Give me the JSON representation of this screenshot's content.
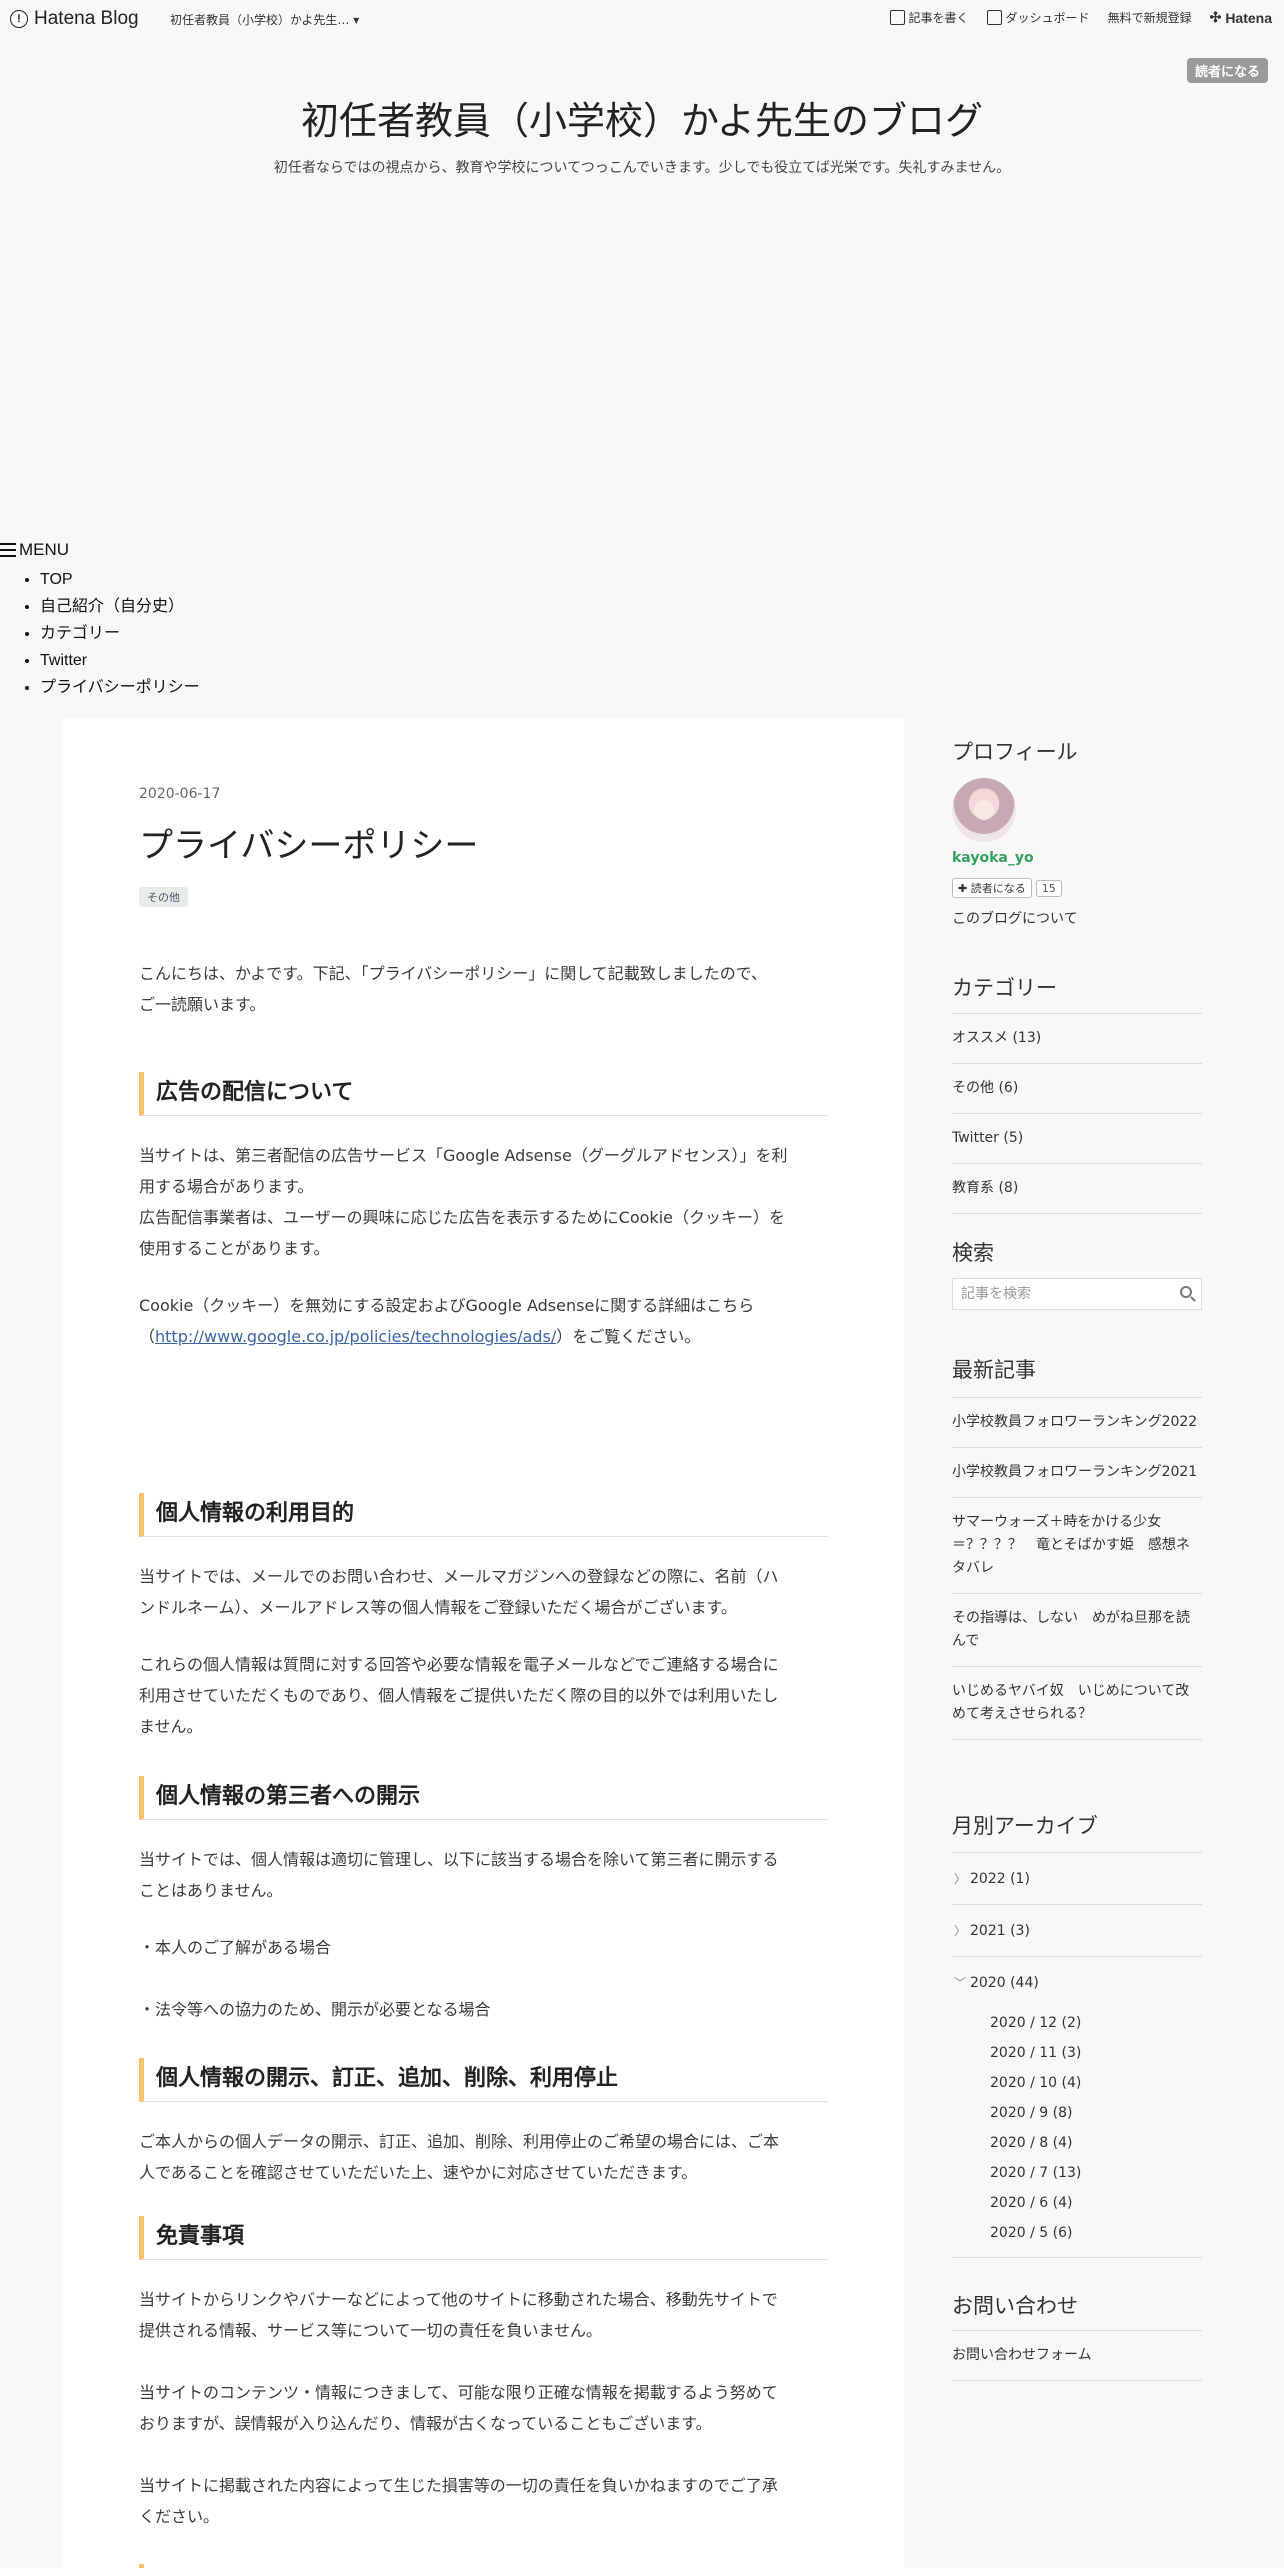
{
  "globalbar": {
    "logo_text": "Hatena Blog",
    "blog_select": "初任者教員（小学校）かよ先生…",
    "write": "記事を書く",
    "dashboard": "ダッシュボード",
    "signup": "無料で新規登録",
    "brand": "Hatena"
  },
  "subscribe_label": "読者になる",
  "blog": {
    "title": "初任者教員（小学校）かよ先生のブログ",
    "description": "初任者ならではの視点から、教育や学校についてつっこんでいきます。少しでも役立てば光栄です。失礼すみません。"
  },
  "menu": {
    "label": "MENU",
    "items": [
      "TOP",
      "自己紹介（自分史）",
      "カテゴリー",
      "Twitter",
      "プライバシーポリシー"
    ]
  },
  "entry": {
    "date": "2020-06-17",
    "title": "プライバシーポリシー",
    "tag": "その他",
    "intro_1": "こんにちは、かよです。下記、「プライバシーポリシー」に関して記載致しましたので、",
    "intro_2": "ご一読願います。",
    "h_ads": "広告の配信について",
    "ads_1": "当サイトは、第三者配信の広告サービス「Google Adsense（グーグルアドセンス）」を利",
    "ads_2": "用する場合があります。",
    "ads_3": "広告配信事業者は、ユーザーの興味に応じた広告を表示するためにCookie（クッキー）を",
    "ads_4": "使用することがあります。",
    "cookie_1": "Cookie（クッキー）を無効にする設定およびGoogle Adsenseに関する詳細はこちら",
    "cookie_pre": "（",
    "cookie_link": "http://www.google.co.jp/policies/technologies/ads/",
    "cookie_post": "）をご覧ください。",
    "h_purpose": "個人情報の利用目的",
    "purpose_1": "当サイトでは、メールでのお問い合わせ、メールマガジンへの登録などの際に、名前（ハ",
    "purpose_2": "ンドルネーム）、メールアドレス等の個人情報をご登録いただく場合がございます。",
    "purpose_3": "これらの個人情報は質問に対する回答や必要な情報を電子メールなどでご連絡する場合に",
    "purpose_4": "利用させていただくものであり、個人情報をご提供いただく際の目的以外では利用いたし",
    "purpose_5": "ません。",
    "h_third": "個人情報の第三者への開示",
    "third_1": "当サイトでは、個人情報は適切に管理し、以下に該当する場合を除いて第三者に開示する",
    "third_2": "ことはありません。",
    "third_3": "・本人のご了解がある場合",
    "third_4": "・法令等への協力のため、開示が必要となる場合",
    "h_disclose": "個人情報の開示、訂正、追加、削除、利用停止",
    "disclose_1": "ご本人からの個人データの開示、訂正、追加、削除、利用停止のご希望の場合には、ご本",
    "disclose_2": "人であることを確認させていただいた上、速やかに対応させていただきます。",
    "h_disclaimer": "免責事項",
    "disc_1": "当サイトからリンクやバナーなどによって他のサイトに移動された場合、移動先サイトで",
    "disc_2": "提供される情報、サービス等について一切の責任を負いません。",
    "disc_3": "当サイトのコンテンツ・情報につきまして、可能な限り正確な情報を掲載するよう努めて",
    "disc_4": "おりますが、誤情報が入り込んだり、情報が古くなっていることもございます。",
    "disc_5": "当サイトに掲載された内容によって生じた損害等の一切の責任を負いかねますのでご了承",
    "disc_6": "ください。"
  },
  "sidebar": {
    "profile_title": "プロフィール",
    "profile_name": "kayoka_yo",
    "subscribe_btn": "読者になる",
    "subscriber_count": "15",
    "about": "このブログについて",
    "category_title": "カテゴリー",
    "categories": [
      "オススメ (13)",
      "その他 (6)",
      "Twitter (5)",
      "教育系 (8)"
    ],
    "search_title": "検索",
    "search_placeholder": "記事を検索",
    "recent_title": "最新記事",
    "recent": [
      "小学校教員フォロワーランキング2022",
      "小学校教員フォロワーランキング2021",
      "サマーウォーズ＋時をかける少女＝？？？？　竜とそばかす姫　感想ネタバレ",
      "その指導は、しない　めがね旦那を読んで",
      "いじめるヤバイ奴　いじめについて改めて考えさせられる？"
    ],
    "archive_title": "月別アーカイブ",
    "archive_years": [
      "2022 (1)",
      "2021 (3)",
      "2020 (44)"
    ],
    "archive_months": [
      "2020 / 12 (2)",
      "2020 / 11 (3)",
      "2020 / 10 (4)",
      "2020 / 9 (8)",
      "2020 / 8 (4)",
      "2020 / 7 (13)",
      "2020 / 6 (4)",
      "2020 / 5 (6)"
    ],
    "contact_title": "お問い合わせ",
    "contact_link": "お問い合わせフォーム"
  }
}
